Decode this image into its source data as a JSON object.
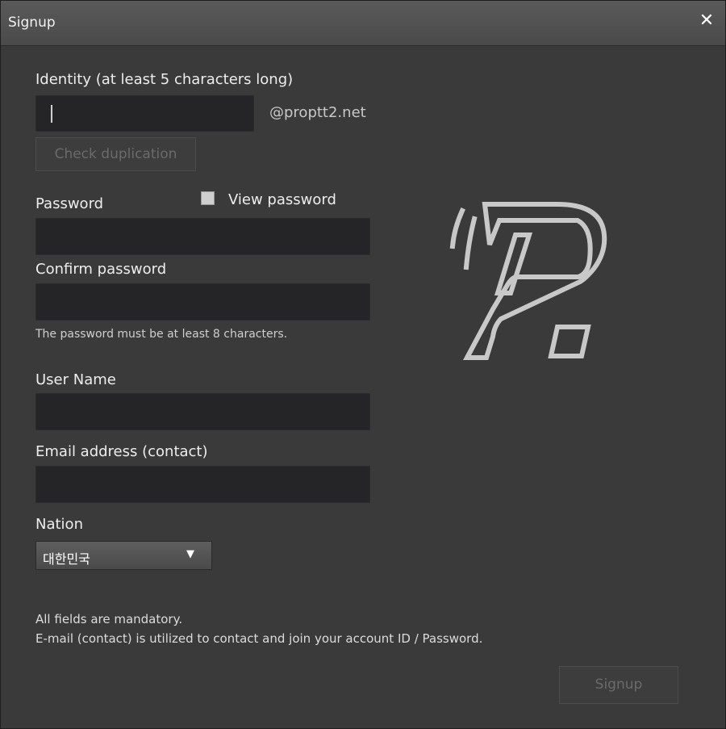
{
  "window": {
    "title": "Signup",
    "close_symbol": "✕"
  },
  "identity": {
    "label": "Identity (at least 5 characters long)",
    "value": "",
    "domain_suffix": "@proptt2.net",
    "check_button": "Check duplication"
  },
  "password": {
    "label": "Password",
    "view_label": "View password",
    "value": ""
  },
  "confirm_password": {
    "label": "Confirm password",
    "value": "",
    "hint": "The password must be at least 8 characters."
  },
  "user_name": {
    "label": "User Name",
    "value": ""
  },
  "email": {
    "label": "Email address (contact)",
    "value": ""
  },
  "nation": {
    "label": "Nation",
    "selected": "대한민국",
    "arrow": "▼"
  },
  "footer": {
    "note1": "All fields are mandatory.",
    "note2": "E-mail (contact) is utilized to contact and join your account ID / Password.",
    "signup_button": "Signup"
  },
  "colors": {
    "background": "#3a3a3a",
    "field": "#252527",
    "titlebar": "#505050",
    "logo": "#c8c8c8"
  },
  "icons": {
    "close": "close-icon",
    "logo": "logo-icon",
    "dropdown": "chevron-down-icon"
  }
}
